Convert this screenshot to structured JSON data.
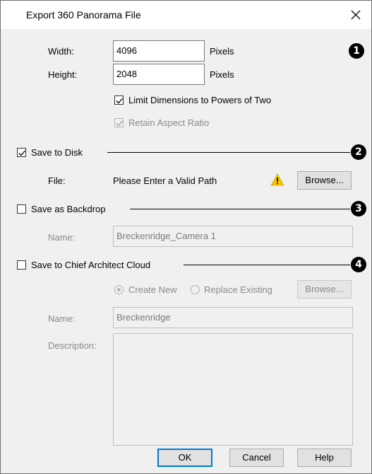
{
  "window": {
    "title": "Export 360 Panorama File"
  },
  "size": {
    "width_label": "Width:",
    "width_value": "4096",
    "width_unit": "Pixels",
    "height_label": "Height:",
    "height_value": "2048",
    "height_unit": "Pixels",
    "limit_pow2_label": "Limit Dimensions to Powers of Two",
    "limit_pow2_checked": true,
    "retain_aspect_label": "Retain Aspect Ratio",
    "retain_aspect_checked": true
  },
  "save_to_disk": {
    "label": "Save to Disk",
    "checked": true,
    "file_label": "File:",
    "file_value": "Please Enter a Valid Path",
    "warning_icon": "warning-icon",
    "browse_label": "Browse..."
  },
  "save_as_backdrop": {
    "label": "Save as Backdrop",
    "checked": false,
    "name_label": "Name:",
    "name_value": "Breckenridge_Camera 1"
  },
  "save_to_cloud": {
    "label": "Save to Chief Architect Cloud",
    "checked": false,
    "create_new_label": "Create New",
    "replace_existing_label": "Replace Existing",
    "browse_label": "Browse...",
    "name_label": "Name:",
    "name_value": "Breckenridge",
    "description_label": "Description:",
    "description_value": ""
  },
  "callouts": [
    "1",
    "2",
    "3",
    "4"
  ],
  "buttons": {
    "ok": "OK",
    "cancel": "Cancel",
    "help": "Help"
  },
  "colors": {
    "accent": "#0078d7",
    "warning": "#f5c400"
  }
}
